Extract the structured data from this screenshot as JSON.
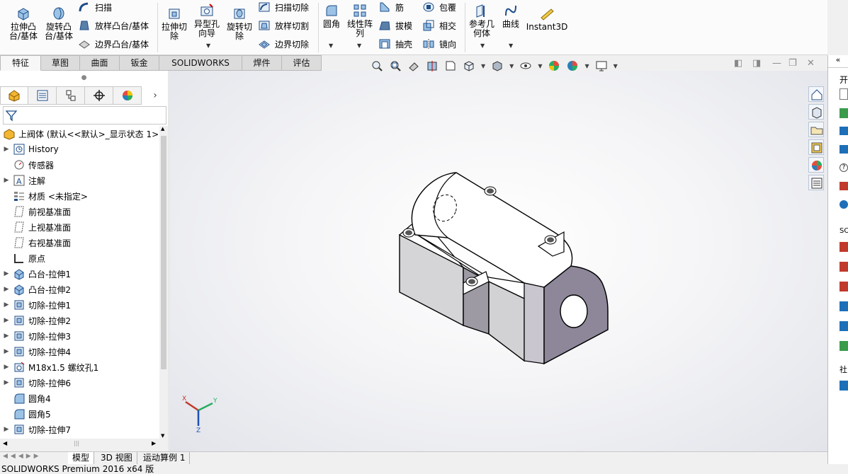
{
  "ribbon": {
    "extrude_boss": "拉伸凸\n台/基体",
    "revolve_boss": "旋转凸\n台/基体",
    "sweep": "扫描",
    "loft": "放样凸台/基体",
    "boundary_boss": "边界凸台/基体",
    "extrude_cut": "拉伸切\n除",
    "hole_wizard": "异型孔\n向导",
    "revolve_cut": "旋转切\n除",
    "sweep_cut": "扫描切除",
    "loft_cut": "放样切割",
    "boundary_cut": "边界切除",
    "fillet": "圆角",
    "linear_pattern": "线性阵\n列",
    "rib": "筋",
    "draft": "拔模",
    "shell": "抽壳",
    "wrap": "包覆",
    "intersect": "相交",
    "mirror": "镜向",
    "ref_geometry": "参考几\n何体",
    "curves": "曲线",
    "instant3d": "Instant3D"
  },
  "tabs": [
    "特征",
    "草图",
    "曲面",
    "钣金",
    "SOLIDWORKS MBD",
    "焊件(D)",
    "评估"
  ],
  "tree": {
    "root": "上阀体 (默认<<默认>_显示状态 1>",
    "items": [
      {
        "label": "History",
        "icon": "history-icon",
        "expand": true
      },
      {
        "label": "传感器",
        "icon": "sensor-icon",
        "expand": false
      },
      {
        "label": "注解",
        "icon": "annotation-icon",
        "expand": true
      },
      {
        "label": "材质 <未指定>",
        "icon": "material-icon",
        "expand": false
      },
      {
        "label": "前视基准面",
        "icon": "plane-icon",
        "expand": false
      },
      {
        "label": "上视基准面",
        "icon": "plane-icon",
        "expand": false
      },
      {
        "label": "右视基准面",
        "icon": "plane-icon",
        "expand": false
      },
      {
        "label": "原点",
        "icon": "origin-icon",
        "expand": false
      },
      {
        "label": "凸台-拉伸1",
        "icon": "boss-extrude-icon",
        "expand": true
      },
      {
        "label": "凸台-拉伸2",
        "icon": "boss-extrude-icon",
        "expand": true
      },
      {
        "label": "切除-拉伸1",
        "icon": "cut-extrude-icon",
        "expand": true
      },
      {
        "label": "切除-拉伸2",
        "icon": "cut-extrude-icon",
        "expand": true
      },
      {
        "label": "切除-拉伸3",
        "icon": "cut-extrude-icon",
        "expand": true
      },
      {
        "label": "切除-拉伸4",
        "icon": "cut-extrude-icon",
        "expand": true
      },
      {
        "label": "M18x1.5 螺纹孔1",
        "icon": "hole-icon",
        "expand": true
      },
      {
        "label": "切除-拉伸6",
        "icon": "cut-extrude-icon",
        "expand": true
      },
      {
        "label": "圆角4",
        "icon": "fillet-icon",
        "expand": false
      },
      {
        "label": "圆角5",
        "icon": "fillet-icon",
        "expand": false
      },
      {
        "label": "切除-拉伸7",
        "icon": "cut-extrude-icon",
        "expand": true
      }
    ]
  },
  "bottom_tabs": [
    "模型",
    "3D 视图",
    "运动算例 1"
  ],
  "status": "SOLIDWORKS Premium 2016 x64 版",
  "triad": {
    "x": "X",
    "y": "Y",
    "z": "Z"
  },
  "right_panel": [
    "开",
    "SO",
    "社"
  ],
  "colors": {
    "accent": "#1a5fa8",
    "model_face": "#ffffff",
    "model_side": "#8d8799"
  }
}
